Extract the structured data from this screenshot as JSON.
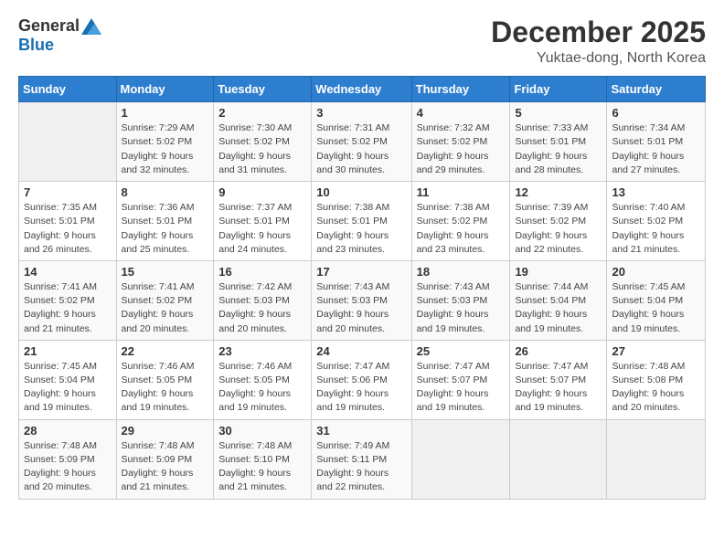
{
  "logo": {
    "general": "General",
    "blue": "Blue"
  },
  "header": {
    "month": "December 2025",
    "location": "Yuktae-dong, North Korea"
  },
  "weekdays": [
    "Sunday",
    "Monday",
    "Tuesday",
    "Wednesday",
    "Thursday",
    "Friday",
    "Saturday"
  ],
  "weeks": [
    [
      {
        "day": "",
        "info": ""
      },
      {
        "day": "1",
        "info": "Sunrise: 7:29 AM\nSunset: 5:02 PM\nDaylight: 9 hours\nand 32 minutes."
      },
      {
        "day": "2",
        "info": "Sunrise: 7:30 AM\nSunset: 5:02 PM\nDaylight: 9 hours\nand 31 minutes."
      },
      {
        "day": "3",
        "info": "Sunrise: 7:31 AM\nSunset: 5:02 PM\nDaylight: 9 hours\nand 30 minutes."
      },
      {
        "day": "4",
        "info": "Sunrise: 7:32 AM\nSunset: 5:02 PM\nDaylight: 9 hours\nand 29 minutes."
      },
      {
        "day": "5",
        "info": "Sunrise: 7:33 AM\nSunset: 5:01 PM\nDaylight: 9 hours\nand 28 minutes."
      },
      {
        "day": "6",
        "info": "Sunrise: 7:34 AM\nSunset: 5:01 PM\nDaylight: 9 hours\nand 27 minutes."
      }
    ],
    [
      {
        "day": "7",
        "info": "Sunrise: 7:35 AM\nSunset: 5:01 PM\nDaylight: 9 hours\nand 26 minutes."
      },
      {
        "day": "8",
        "info": "Sunrise: 7:36 AM\nSunset: 5:01 PM\nDaylight: 9 hours\nand 25 minutes."
      },
      {
        "day": "9",
        "info": "Sunrise: 7:37 AM\nSunset: 5:01 PM\nDaylight: 9 hours\nand 24 minutes."
      },
      {
        "day": "10",
        "info": "Sunrise: 7:38 AM\nSunset: 5:01 PM\nDaylight: 9 hours\nand 23 minutes."
      },
      {
        "day": "11",
        "info": "Sunrise: 7:38 AM\nSunset: 5:02 PM\nDaylight: 9 hours\nand 23 minutes."
      },
      {
        "day": "12",
        "info": "Sunrise: 7:39 AM\nSunset: 5:02 PM\nDaylight: 9 hours\nand 22 minutes."
      },
      {
        "day": "13",
        "info": "Sunrise: 7:40 AM\nSunset: 5:02 PM\nDaylight: 9 hours\nand 21 minutes."
      }
    ],
    [
      {
        "day": "14",
        "info": "Sunrise: 7:41 AM\nSunset: 5:02 PM\nDaylight: 9 hours\nand 21 minutes."
      },
      {
        "day": "15",
        "info": "Sunrise: 7:41 AM\nSunset: 5:02 PM\nDaylight: 9 hours\nand 20 minutes."
      },
      {
        "day": "16",
        "info": "Sunrise: 7:42 AM\nSunset: 5:03 PM\nDaylight: 9 hours\nand 20 minutes."
      },
      {
        "day": "17",
        "info": "Sunrise: 7:43 AM\nSunset: 5:03 PM\nDaylight: 9 hours\nand 20 minutes."
      },
      {
        "day": "18",
        "info": "Sunrise: 7:43 AM\nSunset: 5:03 PM\nDaylight: 9 hours\nand 19 minutes."
      },
      {
        "day": "19",
        "info": "Sunrise: 7:44 AM\nSunset: 5:04 PM\nDaylight: 9 hours\nand 19 minutes."
      },
      {
        "day": "20",
        "info": "Sunrise: 7:45 AM\nSunset: 5:04 PM\nDaylight: 9 hours\nand 19 minutes."
      }
    ],
    [
      {
        "day": "21",
        "info": "Sunrise: 7:45 AM\nSunset: 5:04 PM\nDaylight: 9 hours\nand 19 minutes."
      },
      {
        "day": "22",
        "info": "Sunrise: 7:46 AM\nSunset: 5:05 PM\nDaylight: 9 hours\nand 19 minutes."
      },
      {
        "day": "23",
        "info": "Sunrise: 7:46 AM\nSunset: 5:05 PM\nDaylight: 9 hours\nand 19 minutes."
      },
      {
        "day": "24",
        "info": "Sunrise: 7:47 AM\nSunset: 5:06 PM\nDaylight: 9 hours\nand 19 minutes."
      },
      {
        "day": "25",
        "info": "Sunrise: 7:47 AM\nSunset: 5:07 PM\nDaylight: 9 hours\nand 19 minutes."
      },
      {
        "day": "26",
        "info": "Sunrise: 7:47 AM\nSunset: 5:07 PM\nDaylight: 9 hours\nand 19 minutes."
      },
      {
        "day": "27",
        "info": "Sunrise: 7:48 AM\nSunset: 5:08 PM\nDaylight: 9 hours\nand 20 minutes."
      }
    ],
    [
      {
        "day": "28",
        "info": "Sunrise: 7:48 AM\nSunset: 5:09 PM\nDaylight: 9 hours\nand 20 minutes."
      },
      {
        "day": "29",
        "info": "Sunrise: 7:48 AM\nSunset: 5:09 PM\nDaylight: 9 hours\nand 21 minutes."
      },
      {
        "day": "30",
        "info": "Sunrise: 7:48 AM\nSunset: 5:10 PM\nDaylight: 9 hours\nand 21 minutes."
      },
      {
        "day": "31",
        "info": "Sunrise: 7:49 AM\nSunset: 5:11 PM\nDaylight: 9 hours\nand 22 minutes."
      },
      {
        "day": "",
        "info": ""
      },
      {
        "day": "",
        "info": ""
      },
      {
        "day": "",
        "info": ""
      }
    ]
  ]
}
